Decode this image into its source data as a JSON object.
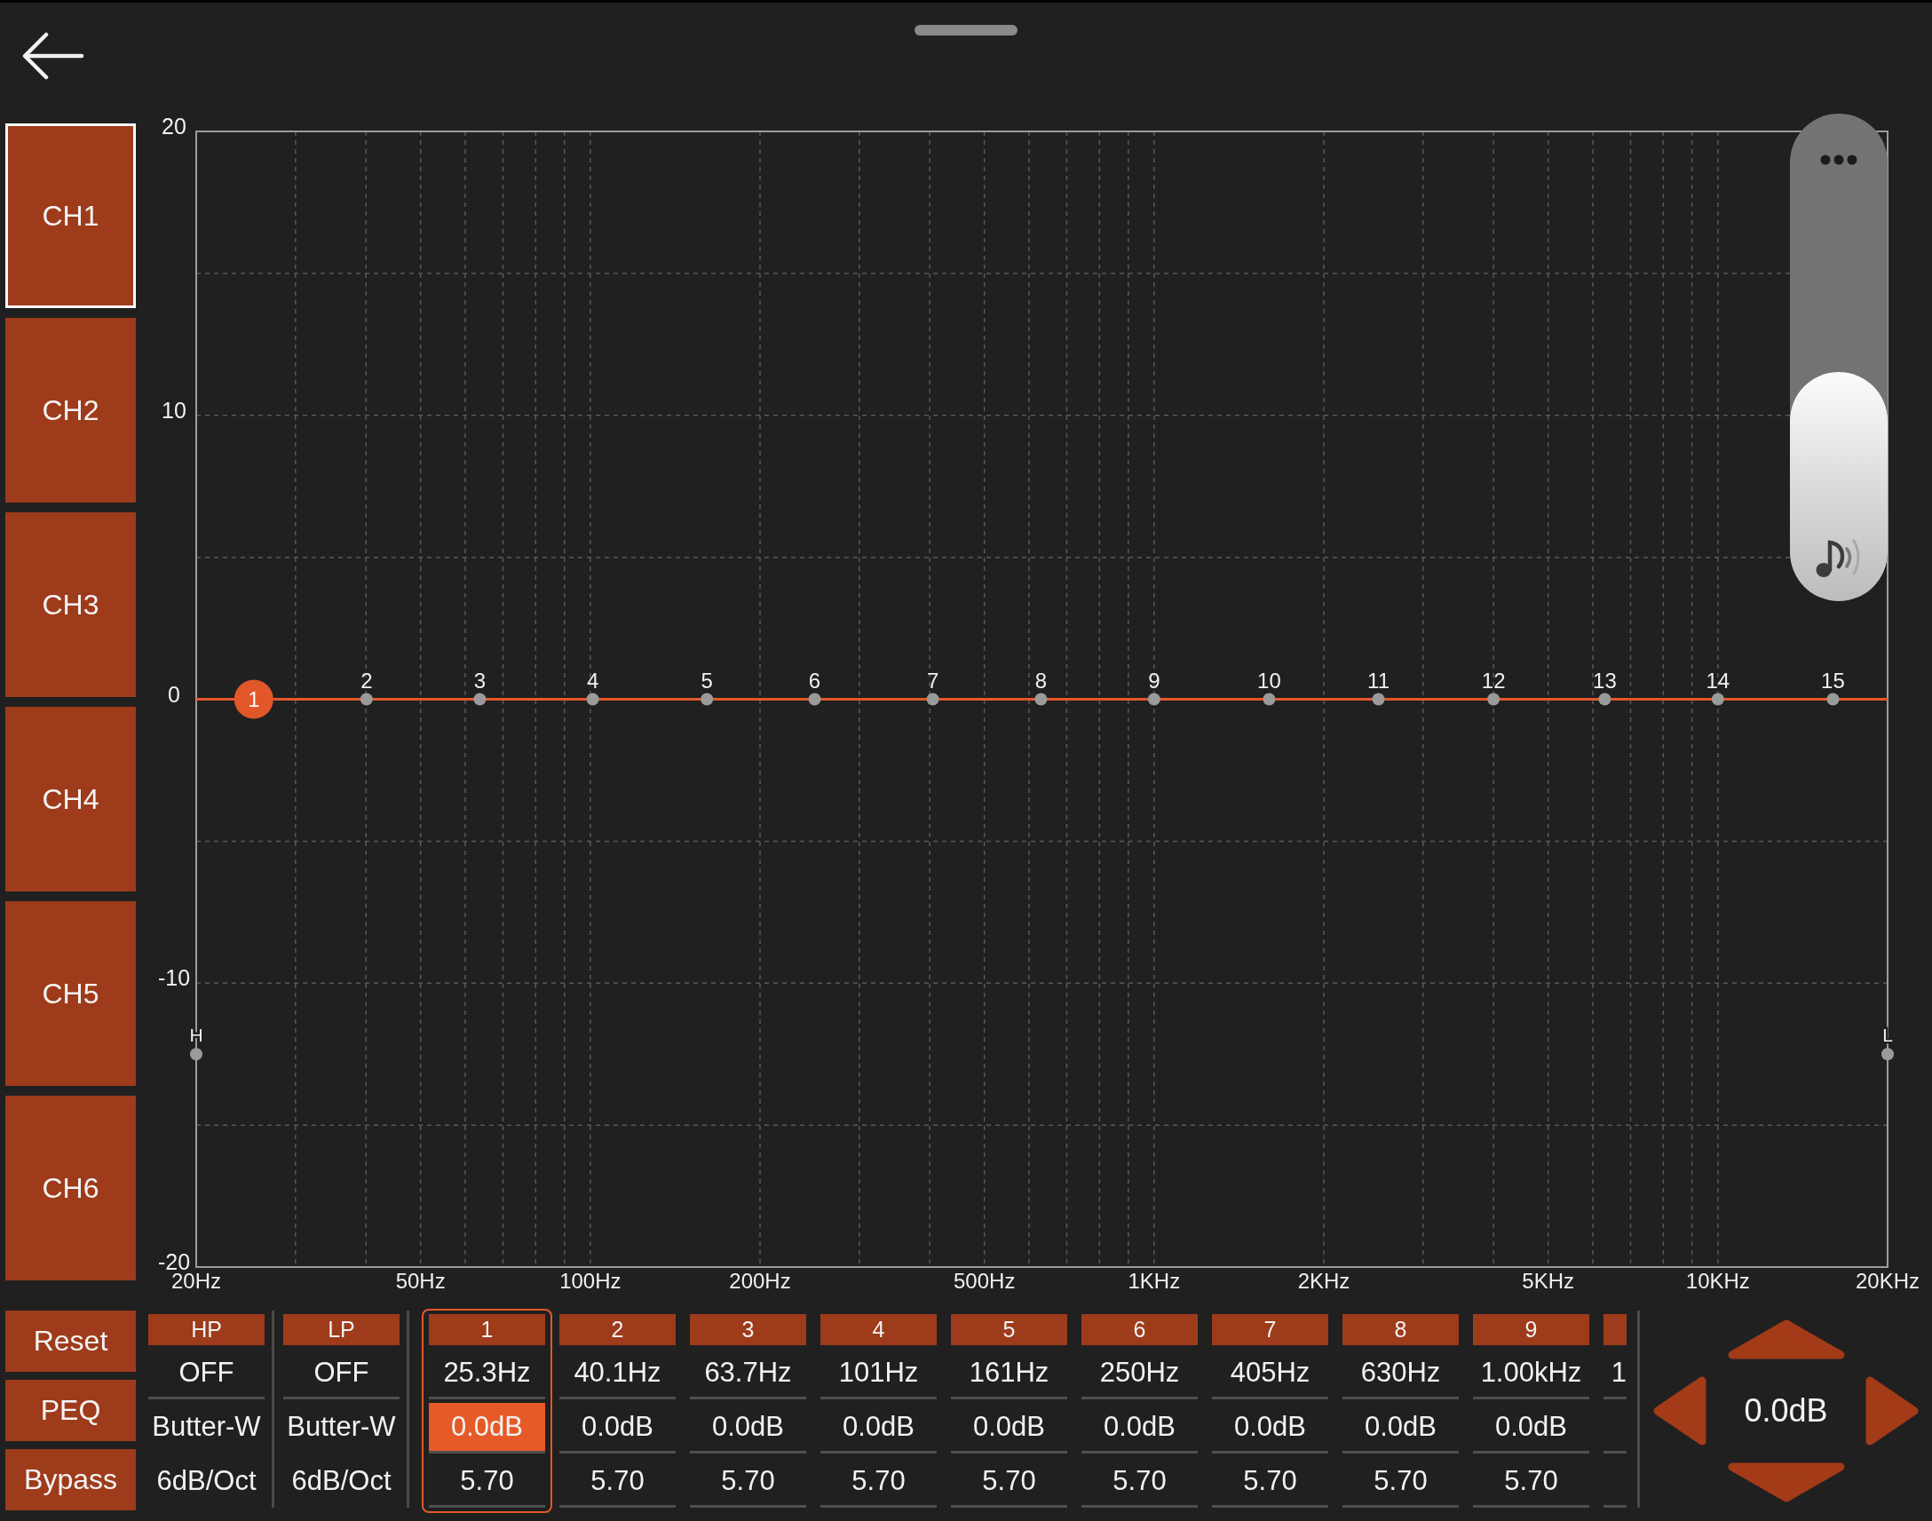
{
  "channels": [
    {
      "label": "CH1",
      "selected": true
    },
    {
      "label": "CH2",
      "selected": false
    },
    {
      "label": "CH3",
      "selected": false
    },
    {
      "label": "CH4",
      "selected": false
    },
    {
      "label": "CH5",
      "selected": false
    },
    {
      "label": "CH6",
      "selected": false
    }
  ],
  "graph": {
    "y_labels": [
      "20",
      "10",
      "0",
      "-10",
      "-20"
    ],
    "x_labels": [
      "20Hz",
      "50Hz",
      "100Hz",
      "200Hz",
      "500Hz",
      "1KHz",
      "2KHz",
      "5KHz",
      "10KHz",
      "20KHz"
    ],
    "band_points": [
      {
        "label": "1",
        "selected": true
      },
      {
        "label": "2",
        "selected": false
      },
      {
        "label": "3",
        "selected": false
      },
      {
        "label": "4",
        "selected": false
      },
      {
        "label": "5",
        "selected": false
      },
      {
        "label": "6",
        "selected": false
      },
      {
        "label": "7",
        "selected": false
      },
      {
        "label": "8",
        "selected": false
      },
      {
        "label": "9",
        "selected": false
      },
      {
        "label": "10",
        "selected": false
      },
      {
        "label": "11",
        "selected": false
      },
      {
        "label": "12",
        "selected": false
      },
      {
        "label": "13",
        "selected": false
      },
      {
        "label": "14",
        "selected": false
      },
      {
        "label": "15",
        "selected": false
      }
    ],
    "limit_points": [
      "H",
      "L"
    ]
  },
  "volume_slider": {
    "level": 0.47
  },
  "actions": [
    "Reset",
    "PEQ",
    "Bypass"
  ],
  "filters": [
    {
      "label": "HP",
      "type": "OFF",
      "shape": "Butter-W",
      "slope": "6dB/Oct"
    },
    {
      "label": "LP",
      "type": "OFF",
      "shape": "Butter-W",
      "slope": "6dB/Oct"
    }
  ],
  "bands": [
    {
      "label": "1",
      "selected": true,
      "cells": [
        {
          "text": "25.3Hz",
          "selected": false
        },
        {
          "text": "0.0dB",
          "selected": true
        },
        {
          "text": "5.70",
          "selected": false
        }
      ]
    },
    {
      "label": "2",
      "selected": false,
      "cells": [
        {
          "text": "40.1Hz",
          "selected": false
        },
        {
          "text": "0.0dB",
          "selected": false
        },
        {
          "text": "5.70",
          "selected": false
        }
      ]
    },
    {
      "label": "3",
      "selected": false,
      "cells": [
        {
          "text": "63.7Hz",
          "selected": false
        },
        {
          "text": "0.0dB",
          "selected": false
        },
        {
          "text": "5.70",
          "selected": false
        }
      ]
    },
    {
      "label": "4",
      "selected": false,
      "cells": [
        {
          "text": "101Hz",
          "selected": false
        },
        {
          "text": "0.0dB",
          "selected": false
        },
        {
          "text": "5.70",
          "selected": false
        }
      ]
    },
    {
      "label": "5",
      "selected": false,
      "cells": [
        {
          "text": "161Hz",
          "selected": false
        },
        {
          "text": "0.0dB",
          "selected": false
        },
        {
          "text": "5.70",
          "selected": false
        }
      ]
    },
    {
      "label": "6",
      "selected": false,
      "cells": [
        {
          "text": "250Hz",
          "selected": false
        },
        {
          "text": "0.0dB",
          "selected": false
        },
        {
          "text": "5.70",
          "selected": false
        }
      ]
    },
    {
      "label": "7",
      "selected": false,
      "cells": [
        {
          "text": "405Hz",
          "selected": false
        },
        {
          "text": "0.0dB",
          "selected": false
        },
        {
          "text": "5.70",
          "selected": false
        }
      ]
    },
    {
      "label": "8",
      "selected": false,
      "cells": [
        {
          "text": "630Hz",
          "selected": false
        },
        {
          "text": "0.0dB",
          "selected": false
        },
        {
          "text": "5.70",
          "selected": false
        }
      ]
    },
    {
      "label": "9",
      "selected": false,
      "cells": [
        {
          "text": "1.00kHz",
          "selected": false
        },
        {
          "text": "0.0dB",
          "selected": false
        },
        {
          "text": "5.70",
          "selected": false
        }
      ]
    },
    {
      "selected": false,
      "cells": [
        {
          "text": "1",
          "selected": false
        }
      ]
    }
  ],
  "adjuster": {
    "value": "0.0dB"
  }
}
